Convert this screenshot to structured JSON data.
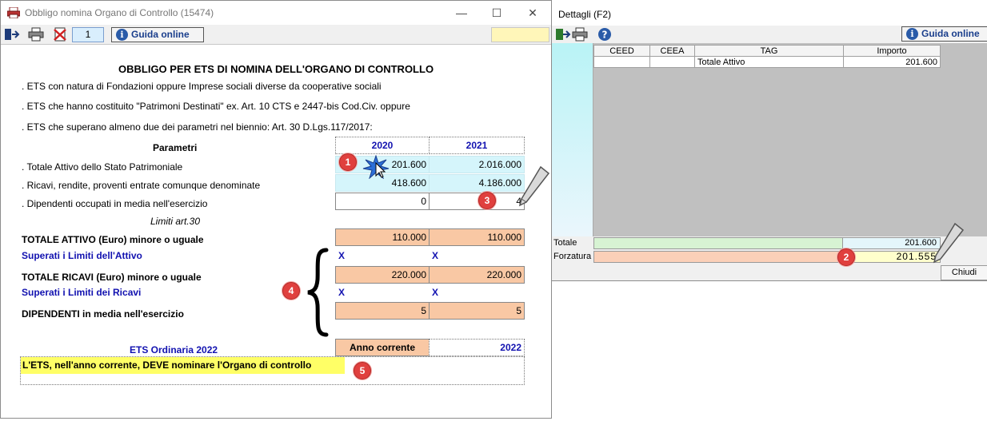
{
  "main_window": {
    "title": "Obbligo nomina Organo di Controllo (15474)",
    "page_number": "1",
    "guida_label": "Guida online"
  },
  "form": {
    "heading": "OBBLIGO PER ETS DI NOMINA DELL'ORGANO DI CONTROLLO",
    "bullets": [
      ". ETS con natura di Fondazioni oppure Imprese sociali diverse da cooperative sociali",
      ". ETS che hanno costituito \"Patrimoni Destinati\" ex. Art. 10 CTS e 2447-bis Cod.Civ. oppure",
      ". ETS che superano almeno due dei parametri nel biennio: Art. 30 D.Lgs.117/2017:"
    ],
    "parametri_header": "Parametri",
    "years": [
      "2020",
      "2021"
    ],
    "rows": [
      {
        "label": ". Totale Attivo dello Stato Patrimoniale",
        "values": [
          "201.600",
          "2.016.000"
        ]
      },
      {
        "label": ". Ricavi, rendite, proventi entrate comunque denominate",
        "values": [
          "418.600",
          "4.186.000"
        ]
      },
      {
        "label": ". Dipendenti occupati in media nell'esercizio",
        "values": [
          "0",
          "4"
        ]
      }
    ],
    "limiti_label": "Limiti art.30",
    "totale_attivo_label": "TOTALE ATTIVO (Euro) minore o uguale",
    "totale_attivo_values": [
      "110.000",
      "110.000"
    ],
    "superati_attivo_label": "Superati i Limiti dell'Attivo",
    "superati_attivo_marks": [
      "X",
      "X"
    ],
    "totale_ricavi_label": "TOTALE RICAVI (Euro) minore o uguale",
    "totale_ricavi_values": [
      "220.000",
      "220.000"
    ],
    "superati_ricavi_label": "Superati i Limiti dei Ricavi",
    "superati_ricavi_marks": [
      "X",
      "X"
    ],
    "dipendenti_label": "DIPENDENTI in media nell'esercizio",
    "dipendenti_values": [
      "5",
      "5"
    ],
    "ets_label": "ETS Ordinaria 2022",
    "anno_corrente_label": "Anno corrente",
    "anno_corrente_value": "2022",
    "result_text": "L'ETS, nell'anno corrente, DEVE nominare l'Organo di controllo"
  },
  "markers": [
    "1",
    "2",
    "3",
    "4",
    "5"
  ],
  "detail_window": {
    "title": "Dettagli (F2)",
    "guida_label": "Guida online",
    "columns": [
      "CEED",
      "CEEA",
      "TAG",
      "Importo"
    ],
    "rows": [
      {
        "ceed": "",
        "ceea": "",
        "tag": "Totale Attivo",
        "importo": "201.600"
      }
    ],
    "totale_label": "Totale",
    "totale_value": "201.600",
    "forzatura_label": "Forzatura",
    "forzatura_value": "201.555",
    "chiudi_label": "Chiudi"
  },
  "colors": {
    "cyan_cell": "#d5f5fb",
    "peach_cell": "#f9c8a4",
    "blue_text": "#1212b0",
    "result_highlight": "#ffff66",
    "marker_red": "#e0403e"
  }
}
